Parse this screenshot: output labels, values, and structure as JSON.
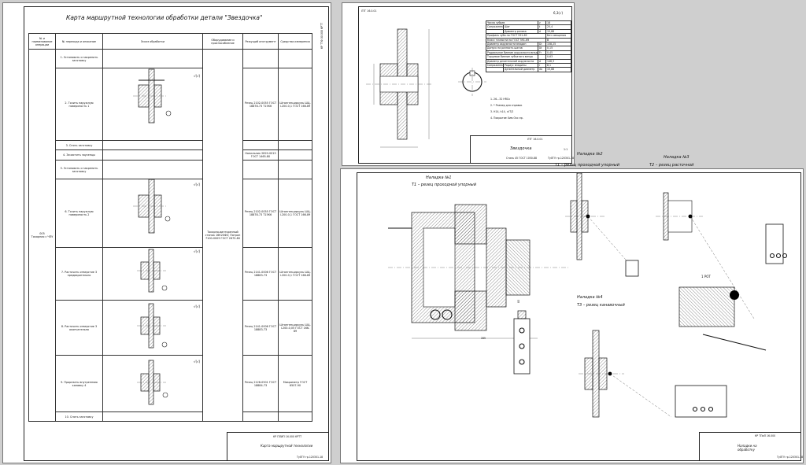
{
  "sheet1": {
    "title": "Карта маршрутной технологии обработки детали \"Звездочка\"",
    "side_code": "КР ТТФ 00.000 КРТТ",
    "headers": [
      "№ и наименование операции",
      "№ перехода и описание",
      "Эскиз обработки",
      "Оборудование и приспособление",
      "Режущий инструмент",
      "Средства измерения"
    ],
    "operation": {
      "number": "005",
      "name": "Токарная с ЧПУ"
    },
    "steps": [
      {
        "text": "1. Установить и закрепить заготовку"
      },
      {
        "text": "2. Точить наружную поверхность 1",
        "tool": "Резец 2102-0055 ГОСТ 18878-73 Т15К6",
        "measure": "Штангенциркуль ШЦ-I-200-0,1 ГОСТ 166-89"
      },
      {
        "text": "3. Снять заготовку"
      },
      {
        "text": "4. Зачистить заусенцы",
        "tool": "Напильник 2820-0015 ГОСТ 1465-80"
      },
      {
        "text": "5. Установить и закрепить заготовку"
      },
      {
        "text": "6. Точить наружную поверхность 2",
        "tool": "Резец 2102-0055 ГОСТ 18878-73 Т15К6",
        "measure": "Штангенциркуль ШЦ-I-200-0,1 ГОСТ 166-89"
      },
      {
        "text": "7. Расточить отверстие 3 предварительно",
        "tool": "Резец 2141-0006 ГОСТ 18883-73",
        "measure": "Штангенциркуль ШЦ-I-200-0,1 ГОСТ 166-89"
      },
      {
        "text": "8. Расточить отверстие 3 окончательно",
        "tool": "Резец 2141-0006 ГОСТ 18883-73",
        "measure": "Штангенциркуль ШЦ-I-200-0,05 ГОСТ 166-89"
      },
      {
        "text": "9. Прорезать внутреннюю канавку 4",
        "tool": "Резец 2128-0501 ГОСТ 18884-73",
        "measure": "Микрометр ГОСТ 6507-90"
      },
      {
        "text": "10. Снять заготовку"
      }
    ],
    "equipment": "Токарно-винторезный станок 16К20Ф3; Патрон 7100-0009 ГОСТ 2675-80",
    "roughness": "√(√)",
    "stamp": {
      "code": "КР ПЛИП 16.000 КРТТ",
      "name": "Карта маршрутной технологии",
      "org": "ТуЛГУ гр.120301-18"
    }
  },
  "sheet2": {
    "side_code": "ЛТГ 16.0.01",
    "roughness": "6,3(√)",
    "params_title": [
      "Число зубьев",
      "z",
      "18"
    ],
    "params": [
      [
        "Сопряженная цепь",
        "Шаг",
        "t",
        "25,4"
      ],
      [
        "",
        "Диаметр ролика",
        "d",
        "15,88"
      ],
      [
        "Профиль зуба по ГОСТ 591-69",
        "",
        "",
        "Без смещения"
      ],
      [
        "Класс точности по ГОСТ 591-69",
        "",
        "",
        "В"
      ],
      [
        "Диаметр окружности впадин",
        "",
        "Di",
        "158,25"
      ],
      [
        "Допуск на разность шагов",
        "",
        "δt",
        "0,15"
      ],
      [
        "Радиальное биение окружности впадин",
        "",
        "Fr",
        "0,45"
      ],
      [
        "Торцевое биение зубчатого венца",
        "",
        "",
        "0,63"
      ],
      [
        "Диаметр делительной окружности",
        "",
        "d",
        "146,3"
      ],
      [
        "Сопряженная цепь",
        "Радиус впадины",
        "r",
        "8,1"
      ],
      [
        "",
        "Делительный диаметр",
        "dа",
        "15,88"
      ]
    ],
    "notes": [
      "1. 26…32 HRCэ",
      "2. * Размер для справок",
      "3. H14, h14, ±IT/2",
      "4. Покрытие Хим.Окс.пр."
    ],
    "stamp": {
      "code": "ЛТГ 16.0.01",
      "name": "Звездочка",
      "material": "Сталь 45 ГОСТ 1050-88",
      "org": "ТуЛГУ гр.120301-18",
      "scale": "1:1"
    }
  },
  "sheet3": {
    "setup1": {
      "title": "Наладка №1",
      "subtitle": "Т1 – резец проходной упорный"
    },
    "setup2": {
      "title": "Наладка №2",
      "subtitle": "Т1 – резец проходной упорный"
    },
    "setup3": {
      "title": "Наладка №3",
      "subtitle": "Т2 – резец расточной"
    },
    "setup4": {
      "title": "Наладка №4",
      "subtitle": "Т3 – резец канавочный"
    },
    "label_rt": "1\nРОТ",
    "dim_bottom": "285",
    "dim_side": "85",
    "stamp": {
      "code": "КР ТПиП 16.000",
      "name": "Наладки на обработку",
      "org": "ТуЛГУ гр.120301-18"
    }
  }
}
